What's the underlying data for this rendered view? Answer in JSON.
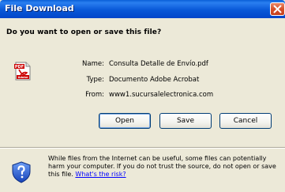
{
  "window": {
    "title": "File Download"
  },
  "dialog": {
    "question": "Do you want to open or save this file?",
    "file": {
      "name_label": "Name:",
      "name_value": "Consulta Detalle de Envío.pdf",
      "type_label": "Type:",
      "type_value": "Documento Adobe Acrobat",
      "from_label": "From:",
      "from_value": "www1.sucursalelectronica.com",
      "icon_badge": "PDF",
      "icon_brand": "Adobe"
    },
    "buttons": {
      "open": "Open",
      "save": "Save",
      "cancel": "Cancel"
    },
    "warning": {
      "text": "While files from the Internet can be useful, some files can potentially harm your computer. If you do not trust the source, do not open or save this file. ",
      "link": "What's the risk?"
    }
  },
  "colors": {
    "titlebar": "#0958d8",
    "dialog_bg": "#ece9d8",
    "close_button": "#d9502a",
    "link": "#0000ff",
    "button_border": "#003c74"
  },
  "icons": {
    "file": "pdf-file-icon",
    "close": "close-icon",
    "warning": "shield-question-icon"
  }
}
